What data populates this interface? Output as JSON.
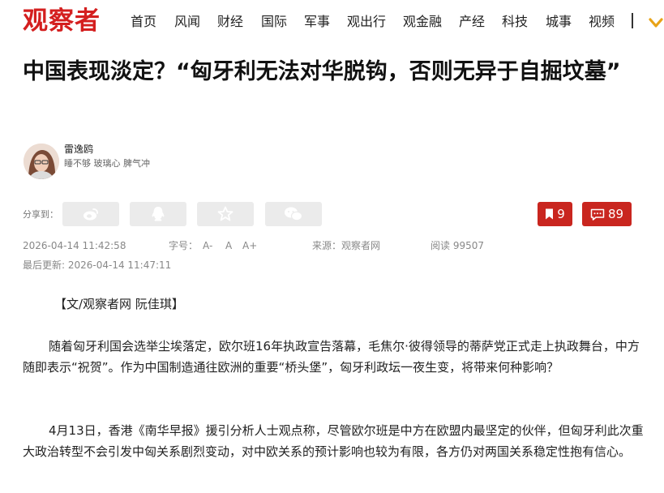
{
  "header": {
    "logo": "观察者",
    "nav": [
      "首页",
      "风闻",
      "财经",
      "国际",
      "军事",
      "观出行",
      "观金融",
      "产经",
      "科技",
      "城事",
      "视频"
    ],
    "divider": "|"
  },
  "article": {
    "title": "中国表现淡定？“匈牙利无法对华脱钩，否则无异于自掘坟墓”",
    "author": {
      "name": "雷逸鸥",
      "bio": "睡不够 玻璃心 脾气冲"
    },
    "share": {
      "label": "分享到：",
      "icons": [
        "weibo-icon",
        "qq-icon",
        "qzone-icon",
        "wechat-icon"
      ]
    },
    "bookmark_count": "9",
    "comment_count": "89",
    "meta": {
      "published": "2026-04-14 11:42:58",
      "font_label": "字号：",
      "font_sizes": [
        "A-",
        "A",
        "A+"
      ],
      "source": "来源：观察者网",
      "views": "阅读 99507",
      "updated": "最后更新: 2026-04-14 11:47:11"
    },
    "paragraphs": [
      "【文/观察者网 阮佳琪】",
      "随着匈牙利国会选举尘埃落定，欧尔班16年执政宣告落幕，毛焦尔·彼得领导的蒂萨党正式走上执政舞台，中方随即表示“祝贺”。作为中国制造通往欧洲的重要“桥头堡”，匈牙利政坛一夜生变，将带来何种影响？",
      "4月13日，香港《南华早报》援引分析人士观点称，尽管欧尔班是中方在欧盟内最坚定的伙伴，但匈牙利此次重大政治转型不会引发中匈关系剧烈变动，对中欧关系的预计影响也较为有限，各方仍对两国关系稳定性抱有信心。"
    ]
  },
  "colors": {
    "brand": "#d41f1f",
    "badge": "#c9261f",
    "share_bg": "#ebebeb",
    "meta_text": "#888888"
  }
}
